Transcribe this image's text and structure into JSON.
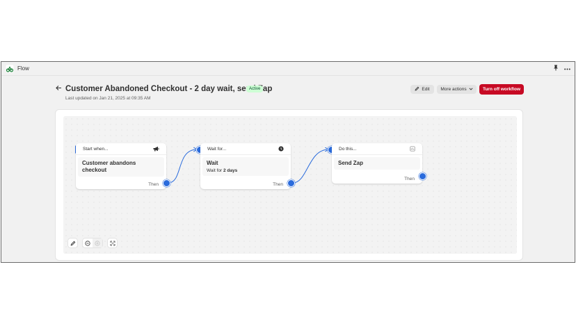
{
  "app": {
    "name": "Flow",
    "icon": "flow-app-icon",
    "pin_icon": "pin-icon",
    "menu_icon": "more-dots-icon"
  },
  "header": {
    "back_icon": "arrow-left-icon",
    "title": "Customer Abandoned Checkout - 2 day wait, send Zap",
    "status_badge": "Active",
    "last_updated": "Last updated on Jan 21, 2025 at 09:35 AM",
    "edit_label": "Edit",
    "more_actions_label": "More actions",
    "turn_off_label": "Turn off workflow"
  },
  "workflow": {
    "nodes": [
      {
        "header": "Start when...",
        "icon": "megaphone-icon",
        "title": "Customer abandons checkout",
        "subtitle_prefix": "",
        "subtitle_value": "",
        "then": "Then"
      },
      {
        "header": "Wait for...",
        "icon": "clock-icon",
        "title": "Wait",
        "subtitle_prefix": "Wait for ",
        "subtitle_value": "2 days",
        "then": "Then"
      },
      {
        "header": "Do this...",
        "icon": "app-block-icon",
        "title": "Send Zap",
        "subtitle_prefix": "",
        "subtitle_value": "",
        "then": "Then"
      }
    ]
  },
  "canvas_tools": {
    "edit_icon": "pencil-icon",
    "zoom_out_icon": "zoom-out-icon",
    "zoom_in_icon": "zoom-in-icon",
    "fit_icon": "fit-view-icon"
  },
  "colors": {
    "accent": "#2a6bdc",
    "danger": "#c70a24",
    "badge_bg": "#cdfed4",
    "badge_text": "#0c5132"
  }
}
